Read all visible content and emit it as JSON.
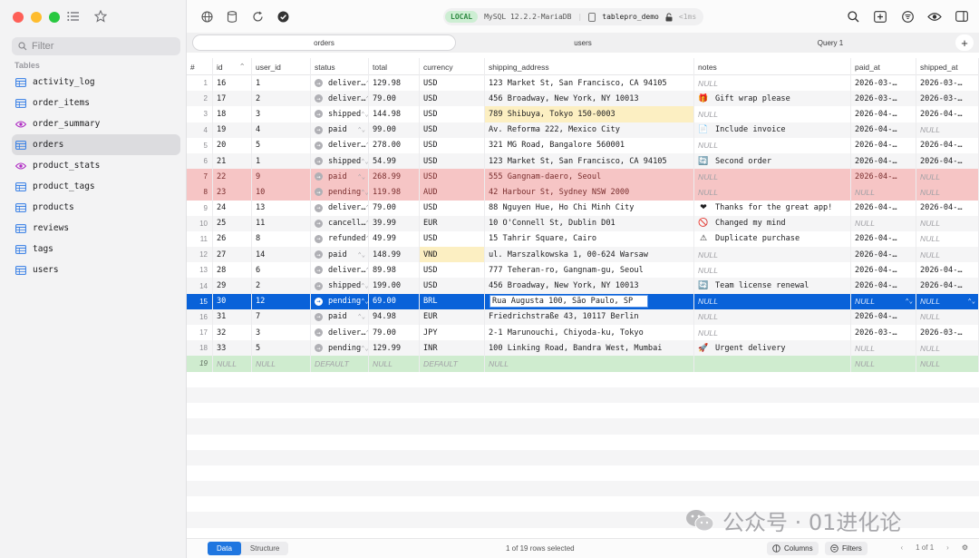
{
  "sidebar": {
    "filter_placeholder": "Filter",
    "section_label": "Tables",
    "items": [
      {
        "label": "activity_log",
        "kind": "table"
      },
      {
        "label": "order_items",
        "kind": "table"
      },
      {
        "label": "order_summary",
        "kind": "view"
      },
      {
        "label": "orders",
        "kind": "table",
        "active": true
      },
      {
        "label": "product_stats",
        "kind": "view"
      },
      {
        "label": "product_tags",
        "kind": "table"
      },
      {
        "label": "products",
        "kind": "table"
      },
      {
        "label": "reviews",
        "kind": "table"
      },
      {
        "label": "tags",
        "kind": "table"
      },
      {
        "label": "users",
        "kind": "table"
      }
    ]
  },
  "toolbar": {
    "env_badge": "LOCAL",
    "server": "MySQL 12.2.2-MariaDB",
    "database": "tablepro_demo",
    "latency": "<1ms"
  },
  "tabs": [
    {
      "label": "orders",
      "active": true
    },
    {
      "label": "users",
      "active": false
    },
    {
      "label": "Query 1",
      "active": false
    }
  ],
  "grid": {
    "columns": [
      "#",
      "id",
      "user_id",
      "status",
      "total",
      "currency",
      "shipping_address",
      "notes",
      "paid_at",
      "shipped_at"
    ],
    "rows": [
      {
        "n": "1",
        "id": "16",
        "user_id": "1",
        "status": "deliver…",
        "total": "129.98",
        "currency": "USD",
        "addr": "123 Market St, San Francisco, CA 94105",
        "notes": "NULL",
        "emoji": "",
        "paid": "2026-03-…",
        "shipped": "2026-03-…",
        "state": "normal"
      },
      {
        "n": "2",
        "id": "17",
        "user_id": "2",
        "status": "deliver…",
        "total": "79.00",
        "currency": "USD",
        "addr": "456 Broadway, New York, NY 10013",
        "notes": "Gift wrap please",
        "emoji": "🎁",
        "paid": "2026-03-…",
        "shipped": "2026-03-…",
        "state": "normal"
      },
      {
        "n": "3",
        "id": "18",
        "user_id": "3",
        "status": "shipped",
        "total": "144.98",
        "currency": "USD",
        "addr": "789 Shibuya, Tokyo 150-0003",
        "notes": "NULL",
        "emoji": "",
        "paid": "2026-04-…",
        "shipped": "2026-04-…",
        "state": "normal",
        "hl_addr": true
      },
      {
        "n": "4",
        "id": "19",
        "user_id": "4",
        "status": "paid",
        "total": "99.00",
        "currency": "USD",
        "addr": "Av. Reforma 222, Mexico City",
        "notes": "Include invoice",
        "emoji": "📄",
        "paid": "2026-04-…",
        "shipped": "NULL",
        "state": "normal"
      },
      {
        "n": "5",
        "id": "20",
        "user_id": "5",
        "status": "deliver…",
        "total": "278.00",
        "currency": "USD",
        "addr": "321 MG Road, Bangalore 560001",
        "notes": "NULL",
        "emoji": "",
        "paid": "2026-04-…",
        "shipped": "2026-04-…",
        "state": "normal"
      },
      {
        "n": "6",
        "id": "21",
        "user_id": "1",
        "status": "shipped",
        "total": "54.99",
        "currency": "USD",
        "addr": "123 Market St, San Francisco, CA 94105",
        "notes": "Second order",
        "emoji": "🔄",
        "paid": "2026-04-…",
        "shipped": "2026-04-…",
        "state": "normal"
      },
      {
        "n": "7",
        "id": "22",
        "user_id": "9",
        "status": "paid",
        "total": "268.99",
        "currency": "USD",
        "addr": "555 Gangnam-daero, Seoul",
        "notes": "NULL",
        "emoji": "",
        "paid": "2026-04-…",
        "shipped": "NULL",
        "state": "deleted"
      },
      {
        "n": "8",
        "id": "23",
        "user_id": "10",
        "status": "pending",
        "total": "119.98",
        "currency": "AUD",
        "addr": "42 Harbour St, Sydney NSW 2000",
        "notes": "NULL",
        "emoji": "",
        "paid": "NULL",
        "shipped": "NULL",
        "state": "deleted"
      },
      {
        "n": "9",
        "id": "24",
        "user_id": "13",
        "status": "deliver…",
        "total": "79.00",
        "currency": "USD",
        "addr": "88 Nguyen Hue, Ho Chi Minh City",
        "notes": "Thanks for the great app!",
        "emoji": "❤",
        "paid": "2026-04-…",
        "shipped": "2026-04-…",
        "state": "normal"
      },
      {
        "n": "10",
        "id": "25",
        "user_id": "11",
        "status": "cancell…",
        "total": "39.99",
        "currency": "EUR",
        "addr": "10 O'Connell St, Dublin D01",
        "notes": "Changed my mind",
        "emoji": "🚫",
        "paid": "NULL",
        "shipped": "NULL",
        "state": "normal"
      },
      {
        "n": "11",
        "id": "26",
        "user_id": "8",
        "status": "refunded",
        "total": "49.99",
        "currency": "USD",
        "addr": "15 Tahrir Square, Cairo",
        "notes": "Duplicate purchase",
        "emoji": "⚠",
        "paid": "2026-04-…",
        "shipped": "NULL",
        "state": "normal"
      },
      {
        "n": "12",
        "id": "27",
        "user_id": "14",
        "status": "paid",
        "total": "148.99",
        "currency": "VND",
        "addr": "ul. Marszalkowska 1, 00-624 Warsaw",
        "notes": "NULL",
        "emoji": "",
        "paid": "2026-04-…",
        "shipped": "NULL",
        "state": "normal",
        "hl_currency": true
      },
      {
        "n": "13",
        "id": "28",
        "user_id": "6",
        "status": "deliver…",
        "total": "89.98",
        "currency": "USD",
        "addr": "777 Teheran-ro, Gangnam-gu, Seoul",
        "notes": "NULL",
        "emoji": "",
        "paid": "2026-04-…",
        "shipped": "2026-04-…",
        "state": "normal"
      },
      {
        "n": "14",
        "id": "29",
        "user_id": "2",
        "status": "shipped",
        "total": "199.00",
        "currency": "USD",
        "addr": "456 Broadway, New York, NY 10013",
        "notes": "Team license renewal",
        "emoji": "🔄",
        "paid": "2026-04-…",
        "shipped": "2026-04-…",
        "state": "normal"
      },
      {
        "n": "15",
        "id": "30",
        "user_id": "12",
        "status": "pending",
        "total": "69.00",
        "currency": "BRL",
        "addr": "Rua Augusta 100, São Paulo, SP",
        "notes": "NULL",
        "emoji": "",
        "paid": "NULL",
        "shipped": "NULL",
        "state": "selected"
      },
      {
        "n": "16",
        "id": "31",
        "user_id": "7",
        "status": "paid",
        "total": "94.98",
        "currency": "EUR",
        "addr": "Friedrichstraße 43, 10117 Berlin",
        "notes": "NULL",
        "emoji": "",
        "paid": "2026-04-…",
        "shipped": "NULL",
        "state": "normal"
      },
      {
        "n": "17",
        "id": "32",
        "user_id": "3",
        "status": "deliver…",
        "total": "79.00",
        "currency": "JPY",
        "addr": "2-1 Marunouchi, Chiyoda-ku, Tokyo",
        "notes": "NULL",
        "emoji": "",
        "paid": "2026-03-…",
        "shipped": "2026-03-…",
        "state": "normal"
      },
      {
        "n": "18",
        "id": "33",
        "user_id": "5",
        "status": "pending",
        "total": "129.99",
        "currency": "INR",
        "addr": "100 Linking Road, Bandra West, Mumbai",
        "notes": "Urgent delivery",
        "emoji": "🚀",
        "paid": "NULL",
        "shipped": "NULL",
        "state": "normal"
      },
      {
        "n": "19",
        "id": "NULL",
        "user_id": "NULL",
        "status": "DEFAULT",
        "total": "NULL",
        "currency": "DEFAULT",
        "addr": "NULL",
        "notes": "",
        "emoji": "",
        "paid": "NULL",
        "shipped": "NULL",
        "state": "new"
      }
    ]
  },
  "footer": {
    "view_data": "Data",
    "view_structure": "Structure",
    "selection": "1 of 19 rows selected",
    "columns_btn": "Columns",
    "filters_btn": "Filters",
    "page": "1 of 1"
  },
  "watermark": "公众号 · 01进化论",
  "colors": {
    "accent": "#0962d9",
    "deleted_row": "#f6c5c5",
    "new_row": "#cfeccf",
    "highlight": "#fcefc2"
  }
}
